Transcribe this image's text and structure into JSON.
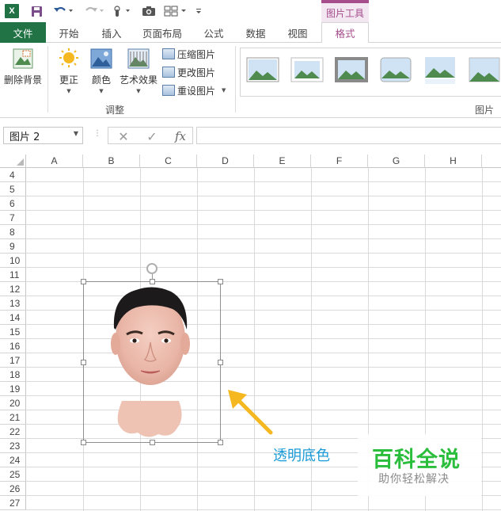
{
  "titlebar": {
    "app_icon_label": "X",
    "context_tab_title": "图片工具"
  },
  "tabs": [
    "文件",
    "开始",
    "插入",
    "页面布局",
    "公式",
    "数据",
    "视图",
    "格式"
  ],
  "ribbon": {
    "remove_bg": "删除背景",
    "corrections": "更正",
    "color": "颜色",
    "artistic": "艺术效果",
    "compress": "压缩图片",
    "change": "更改图片",
    "reset": "重设图片",
    "group_adjust": "调整",
    "group_styles": "图片样"
  },
  "formula_bar": {
    "name_box": "图片 2",
    "cancel_symbol": "✕",
    "enter_symbol": "✓",
    "fx_label": "fx"
  },
  "grid": {
    "columns": [
      "A",
      "B",
      "C",
      "D",
      "E",
      "F",
      "G",
      "H"
    ],
    "rows": [
      "4",
      "5",
      "6",
      "7",
      "8",
      "9",
      "10",
      "11",
      "12",
      "13",
      "14",
      "15",
      "16",
      "17",
      "18",
      "19",
      "20",
      "21",
      "22",
      "23",
      "24",
      "25",
      "26",
      "27"
    ]
  },
  "annotation": "透明底色",
  "watermark": {
    "title": "百科全说",
    "subtitle": "助你轻松解决"
  },
  "colors": {
    "excel_green": "#217346",
    "context_accent": "#a64d8c",
    "annotation_blue": "#1a9ad6",
    "arrow_yellow": "#f5b820",
    "watermark_green": "#2bbd3c"
  }
}
